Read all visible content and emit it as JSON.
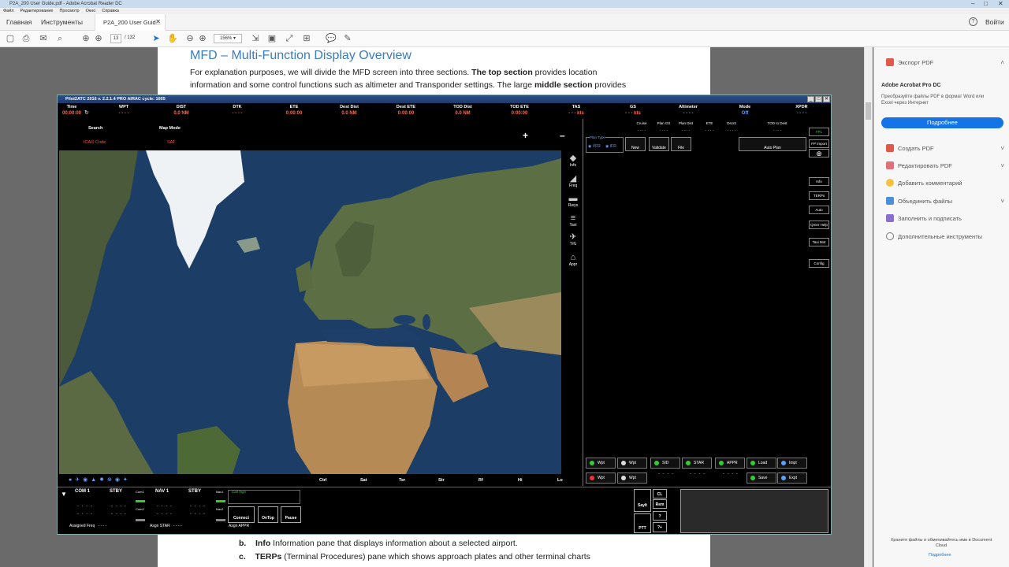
{
  "window_title": "P2A_200 User Guide.pdf - Adobe Acrobat Reader DC",
  "menu": [
    "Файл",
    "Редактирование",
    "Просмотр",
    "Окно",
    "Справка"
  ],
  "tabs": {
    "home": "Главная",
    "tools": "Инструменты",
    "doc": "P2A_200 User Guid...",
    "signin": "Войти"
  },
  "toolbar": {
    "page_current": "13",
    "page_total": "/ 132",
    "zoom": "156%"
  },
  "doc": {
    "heading": "MFD – Multi-Function Display Overview",
    "p1_a": "For explanation purposes, we will divide the MFD screen into three sections.  ",
    "p1_b": "The top section",
    "p1_c": " provides location",
    "p2_a": "information and some control functions such as altimeter and Transponder settings.  The large ",
    "p2_b": "middle section",
    "p2_c": " provides",
    "li_b_marker": "b.",
    "li_b_title": "Info",
    "li_b_text": " Information pane that displays information about a selected airport.",
    "li_c_marker": "c.",
    "li_c_title": "TERPs",
    "li_c_text": " (Terminal Procedures) pane which shows approach plates and other terminal charts"
  },
  "rpanel": {
    "export": "Экспорт PDF",
    "promo_title": "Adobe Acrobat Pro DC",
    "promo_text": "Преобразуйте файлы PDF в формат Word или Excel через Интернет",
    "promo_btn": "Подробнее",
    "items": [
      "Создать PDF",
      "Редактировать PDF",
      "Добавить комментарий",
      "Объединить файлы",
      "Заполнить и подписать",
      "Дополнительные инструменты"
    ],
    "footer": "Храните файлы и обменивайтесь ими в Document Cloud",
    "footer_link": "Подробнее"
  },
  "app": {
    "title": "Pilot2ATC 2016 v. 2.2.1.4 PRO    AIRAC cycle: 1605",
    "header": [
      {
        "label": "Time",
        "value": "00:00:00",
        "color": "#ff6b4a"
      },
      {
        "label": "WPT",
        "value": "- - - -",
        "color": "#ff6b4a"
      },
      {
        "label": "DIST",
        "value": "0.0 NM",
        "color": "#ff6b4a"
      },
      {
        "label": "DTK",
        "value": "- - - -",
        "color": "#ff6b4a"
      },
      {
        "label": "ETE",
        "value": "0:00:00",
        "color": "#ff6b4a"
      },
      {
        "label": "Dest Dist",
        "value": "0.0 NM",
        "color": "#ff6b4a"
      },
      {
        "label": "Dest ETE",
        "value": "0:00:00",
        "color": "#ff6b4a"
      },
      {
        "label": "TOD Dist",
        "value": "0.0 NM",
        "color": "#ff6b4a"
      },
      {
        "label": "TOD ETE",
        "value": "0:00:00",
        "color": "#ff6b4a"
      },
      {
        "label": "TAS",
        "value": "- - - kts",
        "color": "#ff6b4a"
      },
      {
        "label": "GS",
        "value": "- - - kts",
        "color": "#ff6b4a"
      },
      {
        "label": "Altimeter",
        "value": "- - - -",
        "color": "#aaaaaa"
      },
      {
        "label": "Mode",
        "value": "Off",
        "color": "#5aa0ff"
      },
      {
        "label": "XPDR",
        "value": "- - - -",
        "color": "#5aa0ff"
      }
    ],
    "search": "Search",
    "icao": "ICAO Code",
    "mapmode": "Map Mode",
    "sat": "SAT",
    "side_icons": [
      "Info",
      "Freq",
      "Rwys",
      "Taxi",
      "Trfc",
      "Appr"
    ],
    "mapbar": [
      "Ctrl",
      "Sat",
      "Ter",
      "Str",
      "Rf",
      "Hi",
      "Lo"
    ],
    "fp_headers": [
      "Cruise",
      "Plan GS",
      "Plan Dist",
      "ETE",
      "Dscnt",
      "TOD to Dest"
    ],
    "fp_vals": [
      "- - - -",
      "- - - -",
      "- - - -",
      "- - - -",
      "- - - -",
      "- - - -"
    ],
    "plan_type": "Plan Type",
    "vfr": "VFR",
    "ifr": "IFR",
    "fp_btns": [
      "New",
      "Validate",
      "File"
    ],
    "autoplan": "Auto Plan",
    "rtabs": [
      "FPL",
      "FP Import",
      "",
      "Info",
      "TERPs",
      "Auto",
      "Qmer Help",
      "Taxi Mnt",
      "Config"
    ],
    "wpt_row1": [
      "Wpt",
      "Wpt",
      "SID",
      "STAR",
      "APPR",
      "Load",
      "Impt"
    ],
    "wpt_row2": [
      "Wpt",
      "Wpt",
      "- - - -",
      "- - - -",
      "- - - -",
      "Save",
      "Expt"
    ],
    "bottom": {
      "com1": "COM 1",
      "stby": "STBY",
      "nav1": "NAV 1",
      "stby2": "STBY",
      "com1_small": "Com1",
      "com2_small": "Com2",
      "nav1_small": "Nav1",
      "nav2_small": "Nav2",
      "assigned_freq": "Assigned Freq",
      "asgn_star": "Asgn STAR",
      "asgn_appr": "Asgn APPR",
      "callsign": "Call Sign",
      "connect": "Connect",
      "ontop": "OnTop",
      "pause": "Pause",
      "sayit": "SayIt",
      "ptt": "PTT",
      "cl": "CL",
      "rem": "Rem",
      "q": "?",
      "qplus": "?+",
      "dashes": "- - - -"
    }
  }
}
